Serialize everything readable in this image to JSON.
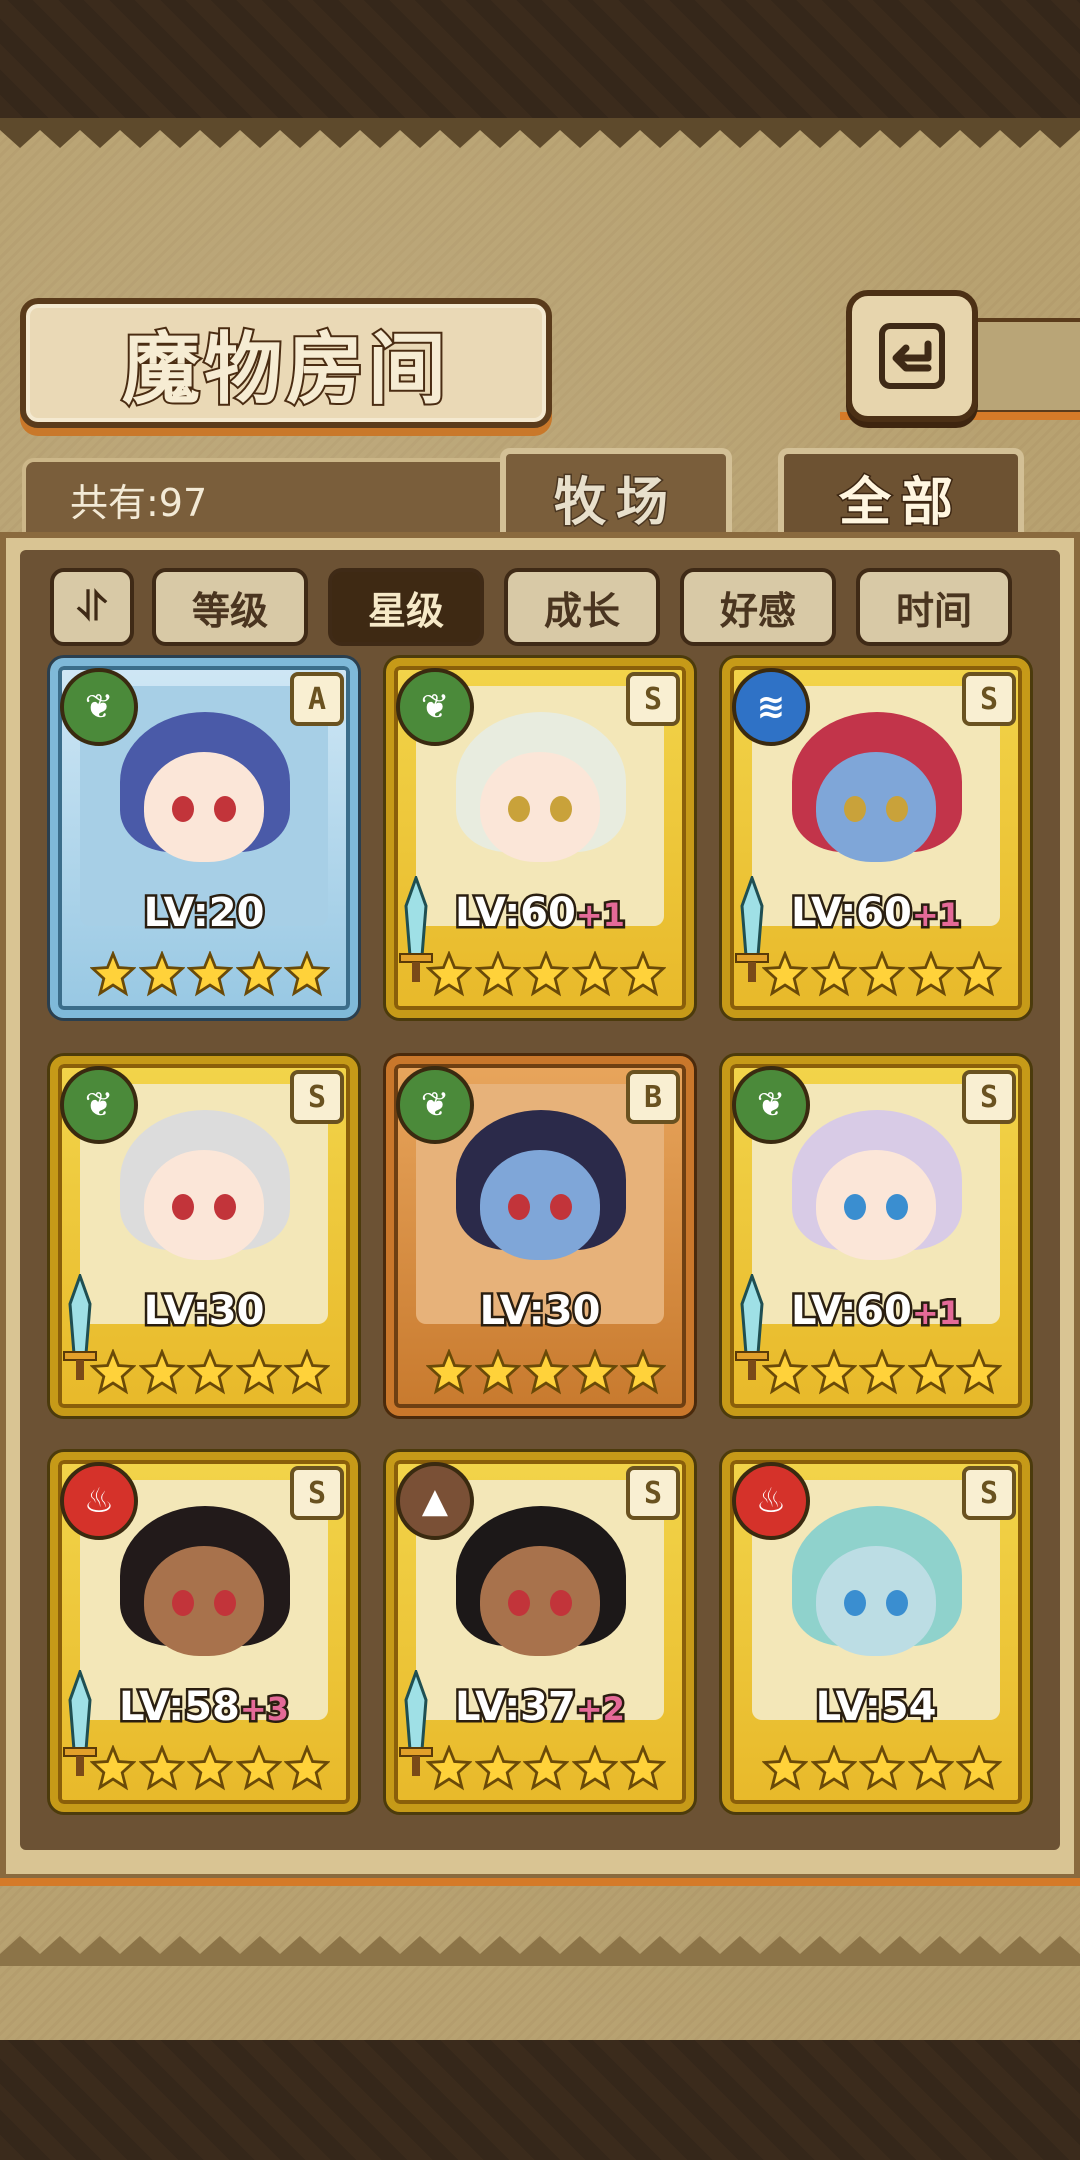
{
  "header": {
    "title": "魔物房间",
    "back_icon": "return-icon"
  },
  "summary": {
    "count_label": "共有:97"
  },
  "tabs": [
    {
      "label": "牧场",
      "active": false
    },
    {
      "label": "全部",
      "active": true
    }
  ],
  "sort": {
    "toggle_symbol": "⥯",
    "options": [
      {
        "label": "等级",
        "selected": false
      },
      {
        "label": "星级",
        "selected": true
      },
      {
        "label": "成长",
        "selected": false
      },
      {
        "label": "好感",
        "selected": false
      },
      {
        "label": "时间",
        "selected": false
      }
    ]
  },
  "monsters": [
    {
      "level": "LV:20",
      "bonus": "",
      "rank": "A",
      "element": "plant",
      "frame": "ice",
      "stars": 5,
      "weapon": false,
      "skin": "light",
      "hair": "#4a5aa8"
    },
    {
      "level": "LV:60",
      "bonus": "+1",
      "rank": "S",
      "element": "plant",
      "frame": "gold",
      "stars": 5,
      "weapon": true,
      "skin": "light",
      "hair": "#e8ecdf"
    },
    {
      "level": "LV:60",
      "bonus": "+1",
      "rank": "S",
      "element": "water",
      "frame": "gold",
      "stars": 5,
      "weapon": true,
      "skin": "blue",
      "hair": "#c2344a"
    },
    {
      "level": "LV:30",
      "bonus": "",
      "rank": "S",
      "element": "plant",
      "frame": "gold",
      "stars": 5,
      "weapon": true,
      "skin": "light",
      "hair": "#dcdcdc"
    },
    {
      "level": "LV:30",
      "bonus": "",
      "rank": "B",
      "element": "plant",
      "frame": "bronze",
      "stars": 5,
      "weapon": false,
      "skin": "blue",
      "hair": "#2b2a4a"
    },
    {
      "level": "LV:60",
      "bonus": "+1",
      "rank": "S",
      "element": "plant",
      "frame": "gold",
      "stars": 5,
      "weapon": true,
      "skin": "light",
      "hair": "#d8cbe6"
    },
    {
      "level": "LV:58",
      "bonus": "+3",
      "rank": "S",
      "element": "fire",
      "frame": "gold",
      "stars": 5,
      "weapon": true,
      "skin": "dark",
      "hair": "#221a1a"
    },
    {
      "level": "LV:37",
      "bonus": "+2",
      "rank": "S",
      "element": "earth",
      "frame": "gold",
      "stars": 5,
      "weapon": true,
      "skin": "dark",
      "hair": "#1c1818"
    },
    {
      "level": "LV:54",
      "bonus": "",
      "rank": "S",
      "element": "fire",
      "frame": "gold",
      "stars": 5,
      "weapon": false,
      "skin": "cyan",
      "hair": "#8fd2cc"
    }
  ],
  "colors": {
    "gold_frame": "#e8b92a",
    "panel": "#6c5234",
    "accent_orange": "#d57a28",
    "bonus_pink": "#e46a98"
  }
}
